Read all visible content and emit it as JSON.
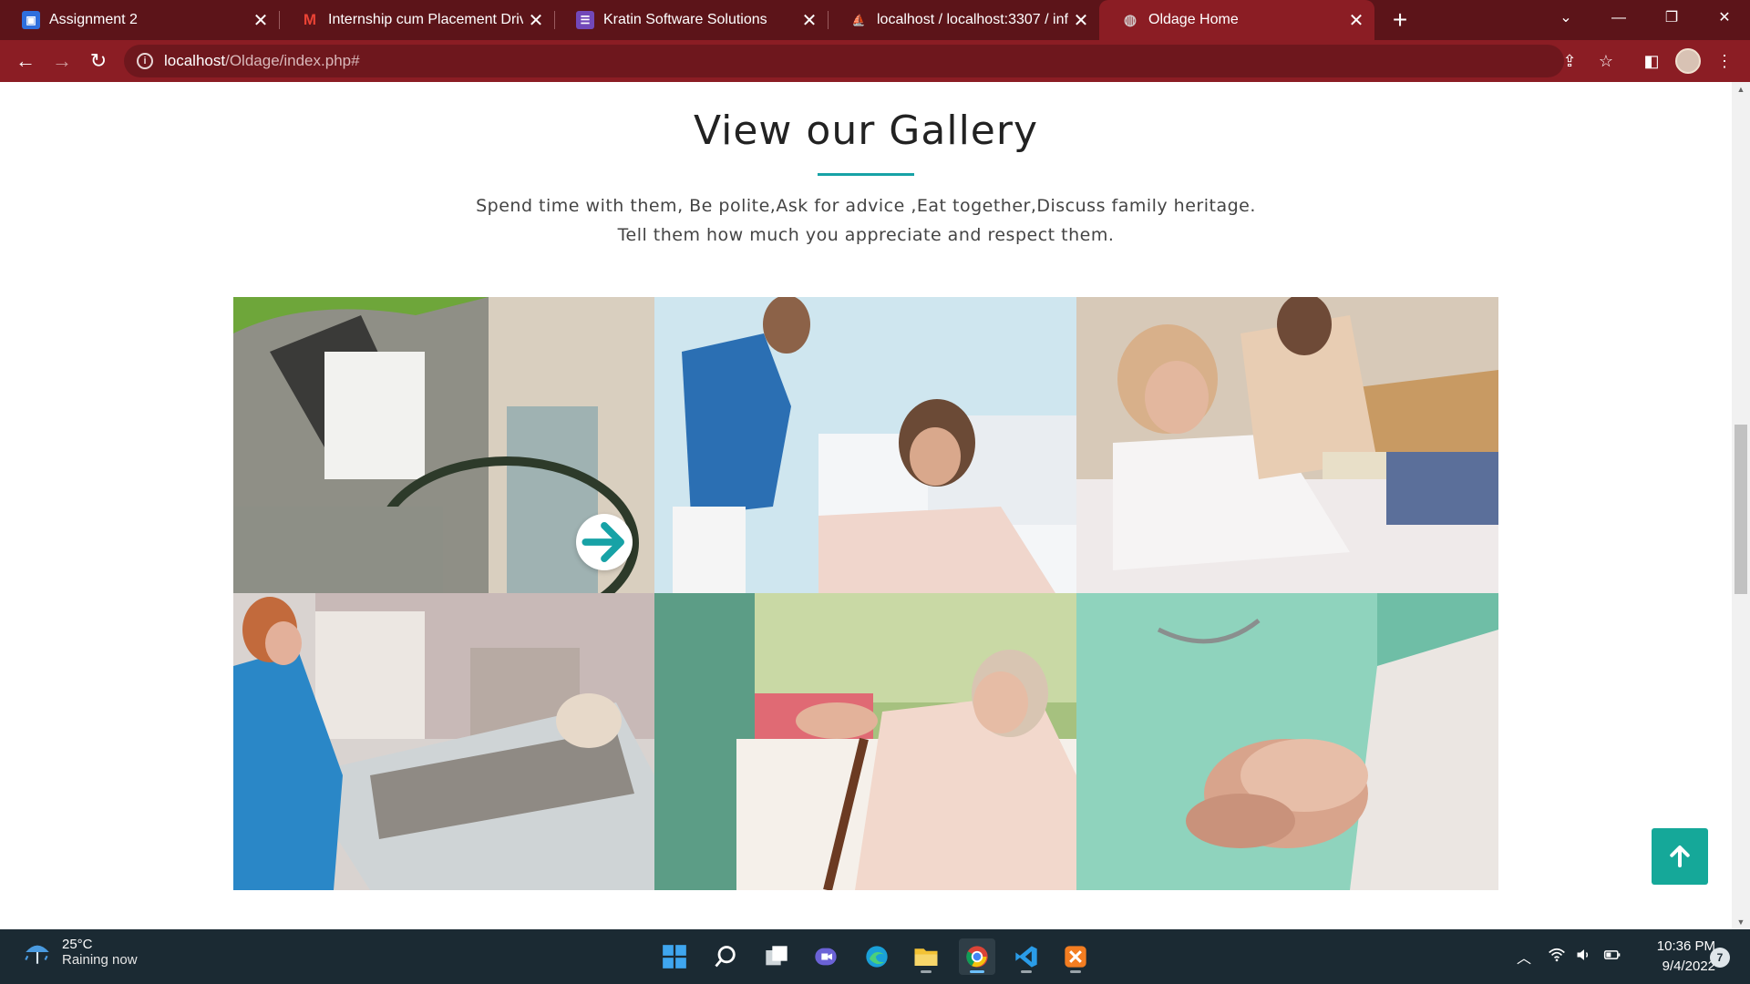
{
  "browser": {
    "tabs": [
      {
        "title": "Assignment 2",
        "icon": "classroom-icon"
      },
      {
        "title": "Internship cum Placement Drive-",
        "icon": "gmail-icon"
      },
      {
        "title": "Kratin Software Solutions",
        "icon": "forms-icon"
      },
      {
        "title": "localhost / localhost:3307 / info /",
        "icon": "phpmyadmin-icon"
      },
      {
        "title": "Oldage Home",
        "icon": "globe-icon",
        "active": true
      }
    ],
    "url_host": "localhost",
    "url_path": "/Oldage/index.php#"
  },
  "gallery": {
    "title": "View our Gallery",
    "subtitle_line1": "Spend time with them, Be polite,Ask for advice ,Eat together,Discuss family heritage.",
    "subtitle_line2": "Tell them how much you appreciate and respect them.",
    "images": [
      {
        "subject": "elderly man in wheelchair with caregiver"
      },
      {
        "subject": "nurse attending woman in bed"
      },
      {
        "subject": "caregiver reading to elderly woman"
      },
      {
        "subject": "nurse with patient in hospital bed"
      },
      {
        "subject": "elderly woman with cane being helped up"
      },
      {
        "subject": "nurse holding patient's hands"
      }
    ],
    "accent_color": "#17a2a6"
  },
  "taskbar": {
    "temperature": "25°C",
    "weather": "Raining now",
    "time": "10:36 PM",
    "date": "9/4/2022",
    "notifications": "7"
  }
}
